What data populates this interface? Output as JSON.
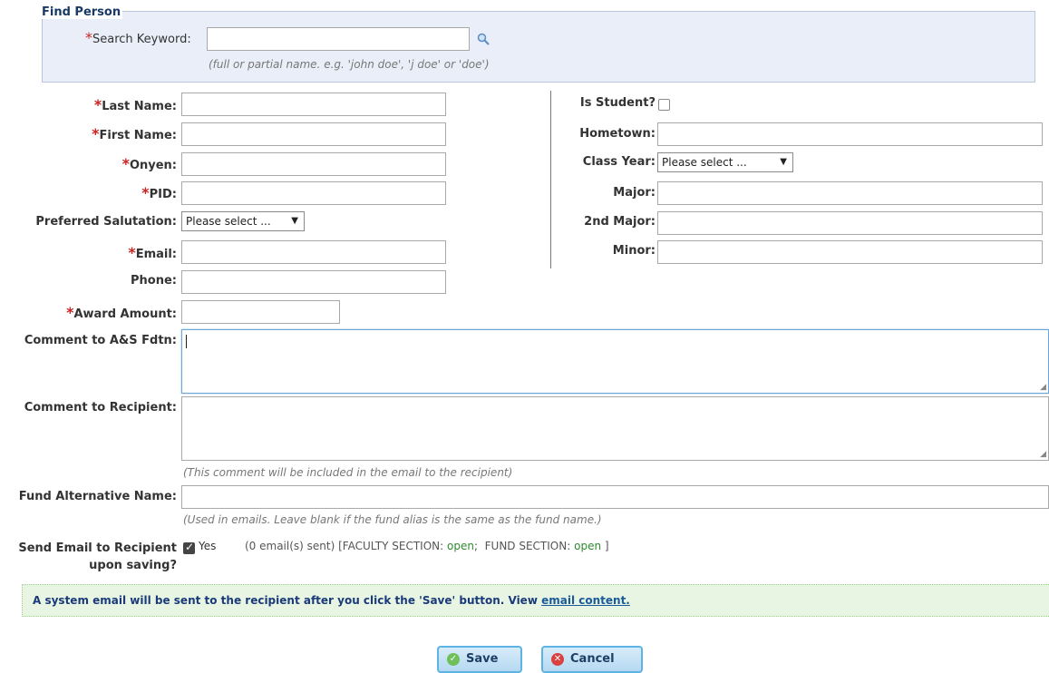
{
  "find_person": {
    "legend": "Find Person",
    "search_label": "Search Keyword:",
    "search_value": "",
    "hint": "(full or partial name. e.g. 'john doe', 'j doe' or 'doe')"
  },
  "required_marker": "*",
  "left_fields": {
    "last_name_label": "Last Name:",
    "first_name_label": "First Name:",
    "onyen_label": "Onyen:",
    "pid_label": "PID:",
    "salutation_label": "Preferred Salutation:",
    "salutation_value": "Please select ...",
    "email_label": "Email:",
    "phone_label": "Phone:",
    "award_label": "Award Amount:"
  },
  "right_fields": {
    "is_student_label": "Is Student?",
    "hometown_label": "Hometown:",
    "class_year_label": "Class Year:",
    "class_year_value": "Please select ...",
    "major_label": "Major:",
    "second_major_label": "2nd Major:",
    "minor_label": "Minor:"
  },
  "comments": {
    "fdtn_label": "Comment to A&S Fdtn:",
    "recipient_label": "Comment to Recipient:",
    "recipient_hint": "(This comment will be included in the email to the recipient)"
  },
  "fund_alt": {
    "label": "Fund Alternative Name:",
    "hint": "(Used in emails. Leave blank if the fund alias is the same as the fund name.)"
  },
  "send_email": {
    "label_line1": "Send Email to Recipient",
    "label_line2": "upon saving?",
    "yes_label": "Yes",
    "status_prefix": "(0 email(s) sent) [FACULTY SECTION:",
    "faculty_status": "open",
    "fund_section": "FUND SECTION:",
    "fund_status": "open",
    "status_suffix": "]"
  },
  "banner": {
    "text": "A system email will be sent to the recipient after you click the 'Save' button. View",
    "link": "email content."
  },
  "buttons": {
    "save": "Save",
    "cancel": "Cancel"
  },
  "colors": {
    "required": "#cc2222",
    "status_open": "#2e8b2e",
    "banner_text": "#1a3a7a"
  }
}
